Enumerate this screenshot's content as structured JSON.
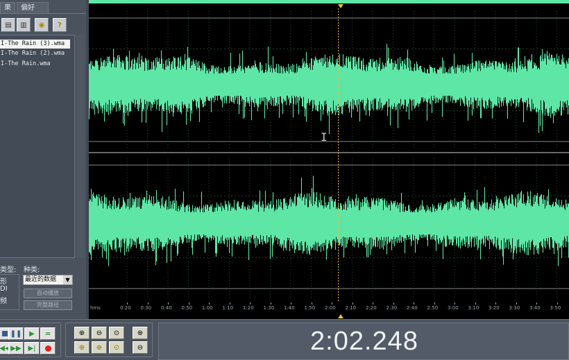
{
  "left_panel": {
    "tabs": [
      "果",
      "偏好"
    ],
    "files": [
      "I-The Rain (3).wma",
      "I-The Rain (2).wma",
      "I-The Rain.wma"
    ],
    "type_label": "类型:",
    "kind_label": "种类:",
    "type_options": [
      "形",
      "DI",
      "频"
    ],
    "kind_select_value": "最近的数据",
    "auto_play_label": "自动播放",
    "full_path_label": "完整路径"
  },
  "timeline": {
    "unit_label": "hms",
    "ticks": [
      "0:20",
      "0:30",
      "0:40",
      "0:50",
      "1:00",
      "1:10",
      "1:20",
      "1:30",
      "1:40",
      "1:50",
      "2:00",
      "2:10",
      "2:20",
      "2:30",
      "2:40",
      "2:50",
      "3:00",
      "3:10",
      "3:20",
      "3:30",
      "3:40",
      "3:50"
    ]
  },
  "time_display": "2:02.248",
  "colors": {
    "waveform": "#5ee6a6",
    "background": "#000000",
    "cursor": "#e5c23a",
    "panel": "#4a525d"
  },
  "icons": {
    "transport": [
      "stop-icon",
      "pause-icon",
      "play-icon",
      "loop-icon",
      "rewind-icon",
      "fast-forward-icon",
      "skip-end-icon",
      "record-icon"
    ],
    "zoom": [
      "zoom-in-icon",
      "zoom-out-icon",
      "zoom-full-icon",
      "zoom-in-selection-icon",
      "zoom-left-icon",
      "zoom-right-icon",
      "zoom-selection-icon",
      "zoom-out-full-icon"
    ]
  }
}
